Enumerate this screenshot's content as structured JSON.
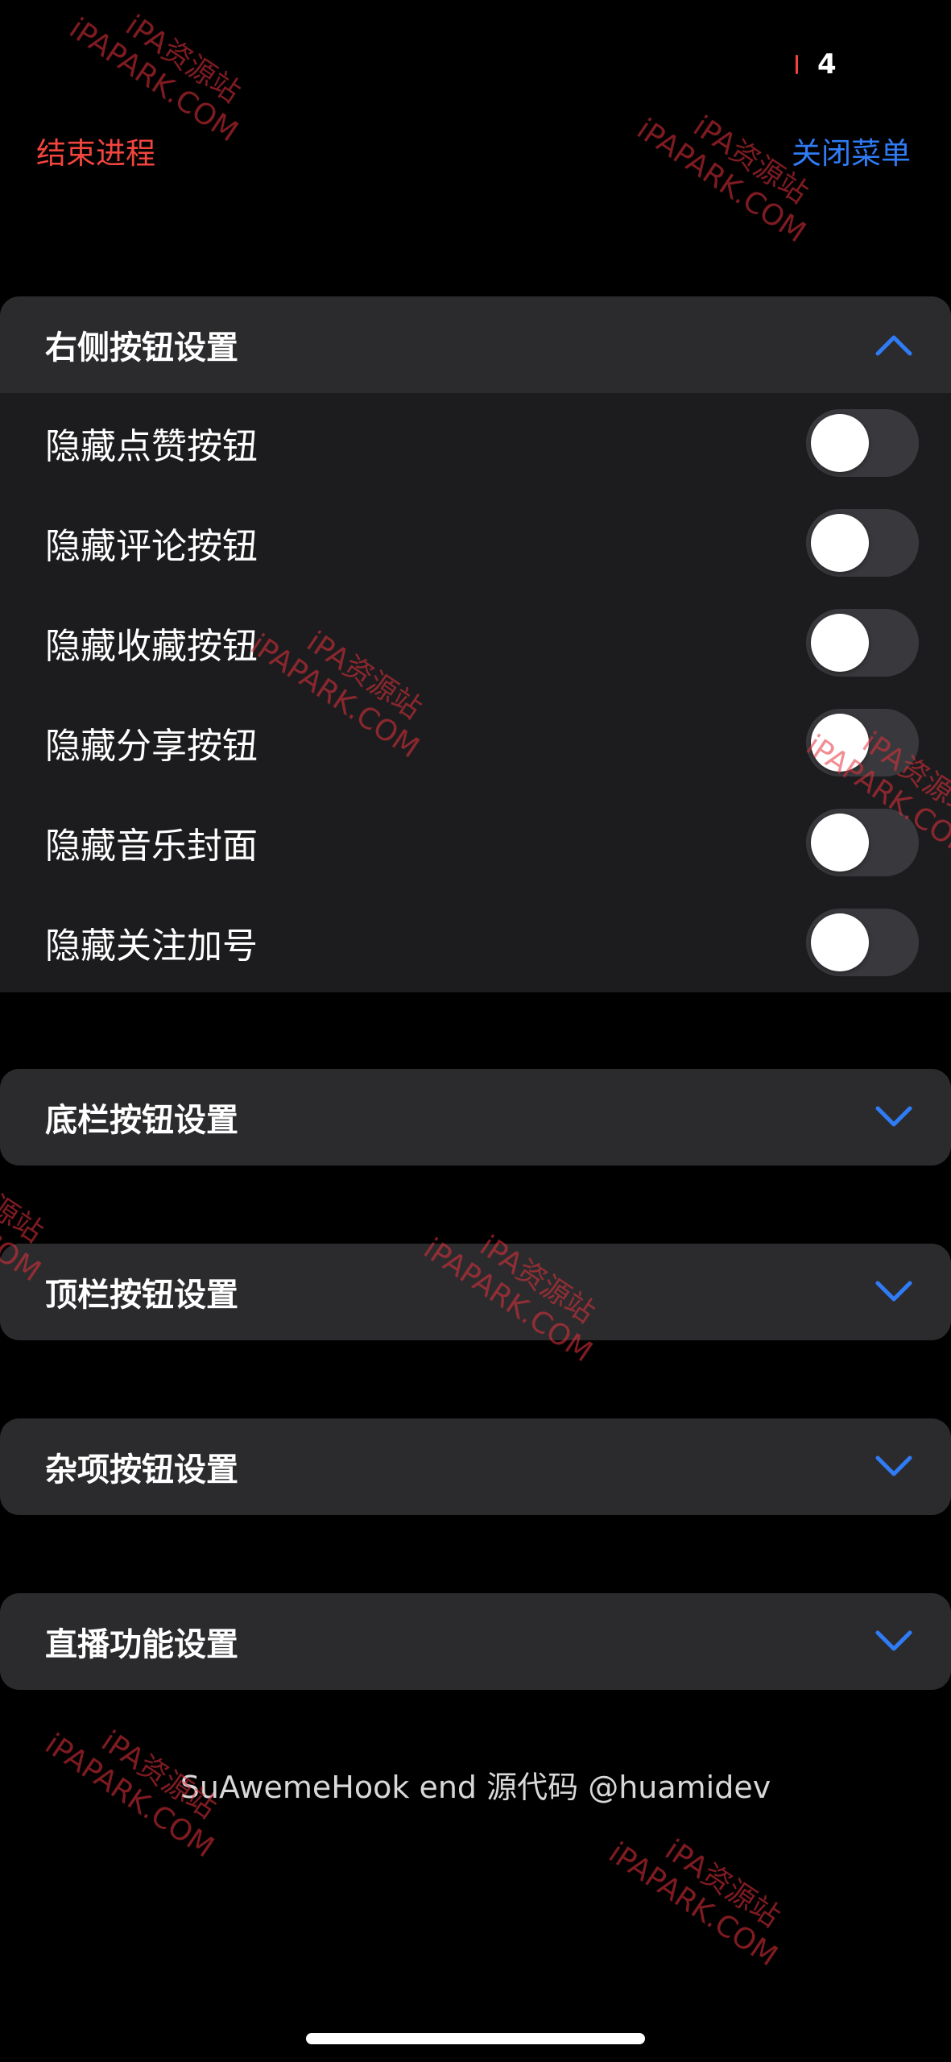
{
  "status_bar": {
    "indicator_value": "4"
  },
  "header": {
    "end_process_label": "结束进程",
    "close_menu_label": "关闭菜单"
  },
  "sections": [
    {
      "title": "右侧按钮设置",
      "expanded": true,
      "items": [
        {
          "label": "隐藏点赞按钮",
          "enabled": false
        },
        {
          "label": "隐藏评论按钮",
          "enabled": false
        },
        {
          "label": "隐藏收藏按钮",
          "enabled": false
        },
        {
          "label": "隐藏分享按钮",
          "enabled": false
        },
        {
          "label": "隐藏音乐封面",
          "enabled": false
        },
        {
          "label": "隐藏关注加号",
          "enabled": false
        }
      ]
    },
    {
      "title": "底栏按钮设置",
      "expanded": false
    },
    {
      "title": "顶栏按钮设置",
      "expanded": false
    },
    {
      "title": "杂项按钮设置",
      "expanded": false
    },
    {
      "title": "直播功能设置",
      "expanded": false
    }
  ],
  "footer": {
    "text": "SuAwemeHook end 源代码 @huamidev"
  },
  "watermark": {
    "line1": "iPA资源站",
    "line2": "iPAPARK.COM"
  },
  "icons": {
    "section_expanded": "chevron-up-icon",
    "section_collapsed": "chevron-down-icon"
  },
  "colors": {
    "background": "#000000",
    "section_header": "#2b2b2d",
    "section_body": "#1c1c1e",
    "accent_blue": "#2f7cf6",
    "destructive_red": "#f2453d",
    "toggle_off": "#39393d",
    "watermark_red": "#e6323c"
  }
}
